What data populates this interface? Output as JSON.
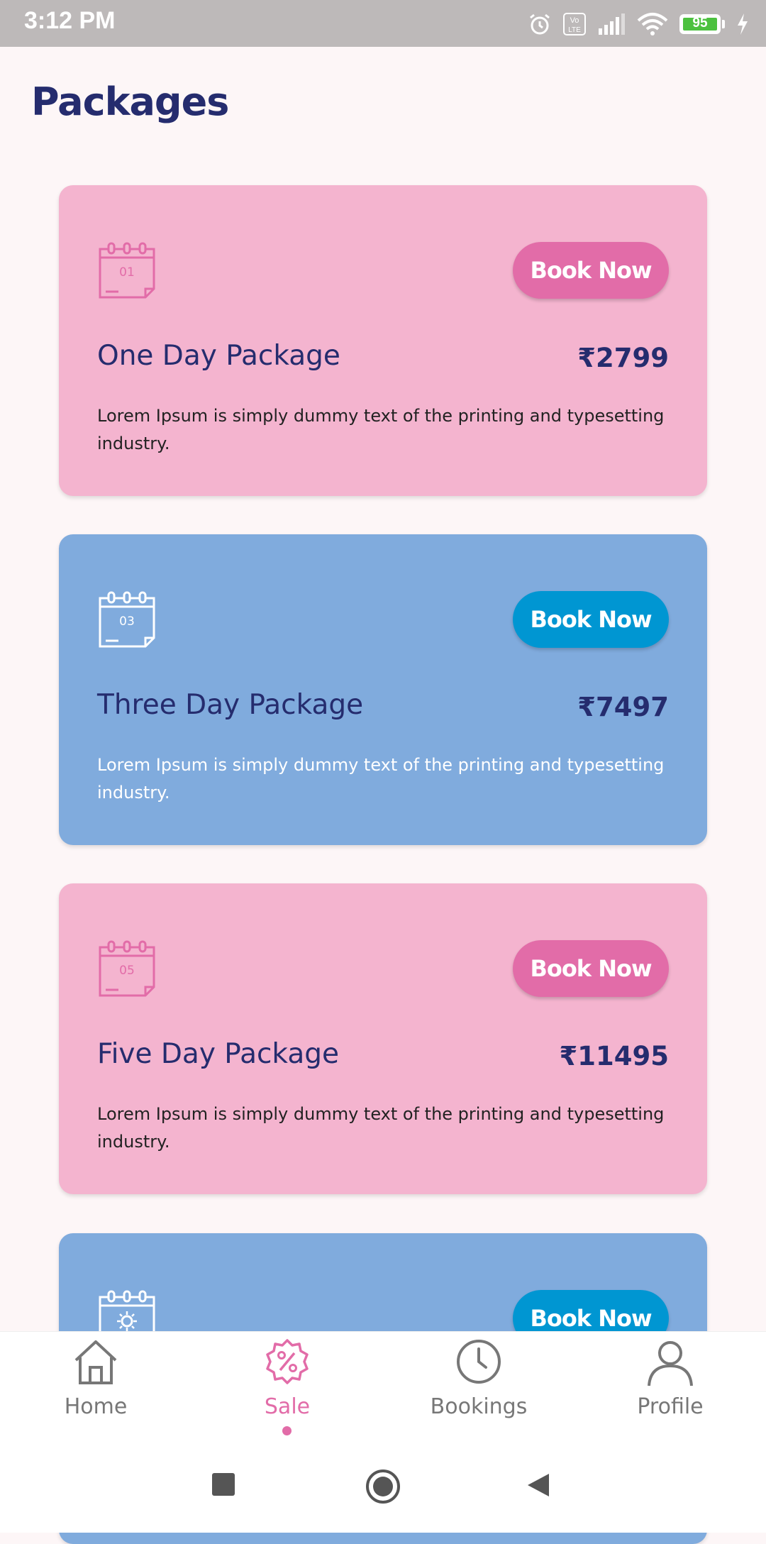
{
  "status_bar": {
    "time": "3:12 PM",
    "battery": "95",
    "icons": [
      "alarm-icon",
      "volte-icon",
      "signal-icon",
      "wifi-icon",
      "battery-icon",
      "charging-icon"
    ]
  },
  "page": {
    "title": "Packages"
  },
  "packages": [
    {
      "icon_label": "01",
      "name": "One Day Package",
      "price": "₹2799",
      "description": "Lorem Ipsum is simply dummy text of the printing and typesetting industry.",
      "button": "Book Now",
      "theme": "pink"
    },
    {
      "icon_label": "03",
      "name": "Three Day Package",
      "price": "₹7497",
      "description": "Lorem Ipsum is simply dummy text of the printing and typesetting industry.",
      "button": "Book Now",
      "theme": "blue"
    },
    {
      "icon_label": "05",
      "name": "Five Day Package",
      "price": "₹11495",
      "description": "Lorem Ipsum is simply dummy text of the printing and typesetting industry.",
      "button": "Book Now",
      "theme": "pink"
    },
    {
      "icon_label": "",
      "name": "",
      "price": "",
      "description": "",
      "button": "Book Now",
      "theme": "blue"
    }
  ],
  "bottom_nav": {
    "items": [
      {
        "label": "Home",
        "icon": "home-icon",
        "active": false
      },
      {
        "label": "Sale",
        "icon": "sale-badge-icon",
        "active": true
      },
      {
        "label": "Bookings",
        "icon": "clock-icon",
        "active": false
      },
      {
        "label": "Profile",
        "icon": "person-icon",
        "active": false
      }
    ]
  },
  "colors": {
    "pink_card": "#f4b4cf",
    "blue_card": "#80abdd",
    "pink_button": "#e26ca8",
    "blue_button": "#0096d2",
    "title_navy": "#252c6e"
  }
}
